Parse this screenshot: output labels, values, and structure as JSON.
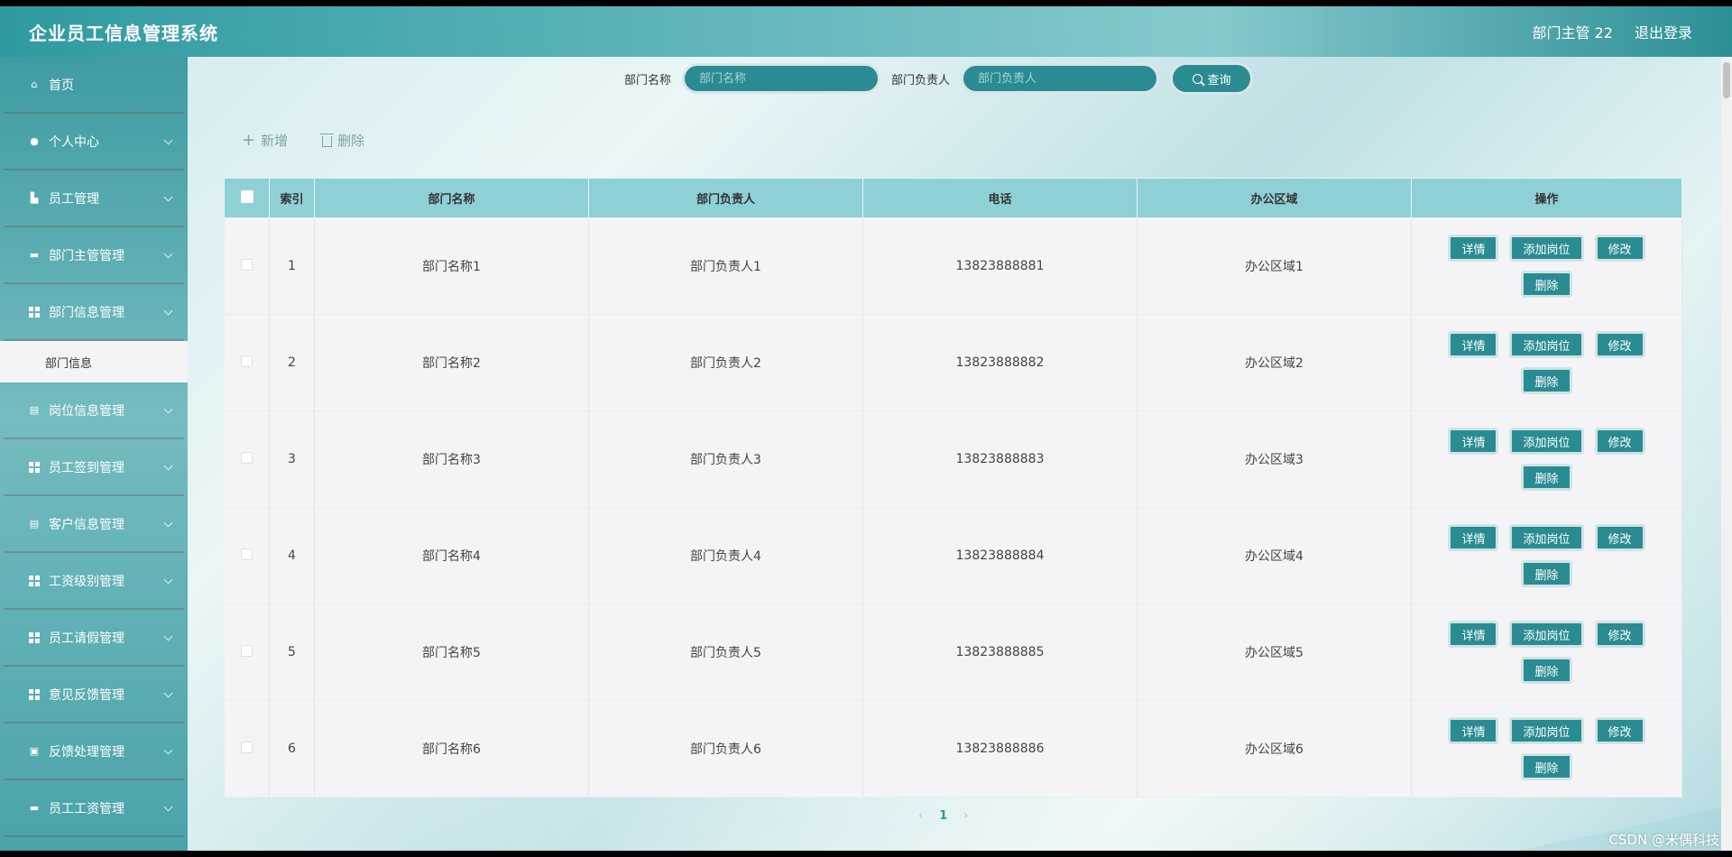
{
  "app": {
    "title": "企业员工信息管理系统"
  },
  "topbar": {
    "user": "部门主管 22",
    "logout": "退出登录"
  },
  "sidebar": {
    "items": [
      {
        "label": "首页",
        "icon": "home-icon"
      },
      {
        "label": "个人中心",
        "icon": "user-icon"
      },
      {
        "label": "员工管理",
        "icon": "building-icon"
      },
      {
        "label": "部门主管管理",
        "icon": "briefcase-icon"
      },
      {
        "label": "部门信息管理",
        "icon": "grid-icon"
      },
      {
        "label": "部门信息",
        "icon": ""
      },
      {
        "label": "岗位信息管理",
        "icon": "clipboard-icon"
      },
      {
        "label": "员工签到管理",
        "icon": "grid-icon"
      },
      {
        "label": "客户信息管理",
        "icon": "clipboard-icon"
      },
      {
        "label": "工资级别管理",
        "icon": "grid-icon"
      },
      {
        "label": "员工请假管理",
        "icon": "grid-icon"
      },
      {
        "label": "意见反馈管理",
        "icon": "grid-icon"
      },
      {
        "label": "反馈处理管理",
        "icon": "printer-icon"
      },
      {
        "label": "员工工资管理",
        "icon": "chat-icon"
      }
    ]
  },
  "search": {
    "dept_name_label": "部门名称",
    "dept_name_placeholder": "部门名称",
    "dept_head_label": "部门负责人",
    "dept_head_placeholder": "部门负责人",
    "query_label": "查询"
  },
  "toolbar": {
    "add_label": "新增",
    "delete_label": "删除"
  },
  "table": {
    "headers": [
      "索引",
      "部门名称",
      "部门负责人",
      "电话",
      "办公区域",
      "操作"
    ],
    "rows": [
      {
        "index": "1",
        "name": "部门名称1",
        "head": "部门负责人1",
        "phone": "13823888881",
        "area": "办公区域1"
      },
      {
        "index": "2",
        "name": "部门名称2",
        "head": "部门负责人2",
        "phone": "13823888882",
        "area": "办公区域2"
      },
      {
        "index": "3",
        "name": "部门名称3",
        "head": "部门负责人3",
        "phone": "13823888883",
        "area": "办公区域3"
      },
      {
        "index": "4",
        "name": "部门名称4",
        "head": "部门负责人4",
        "phone": "13823888884",
        "area": "办公区域4"
      },
      {
        "index": "5",
        "name": "部门名称5",
        "head": "部门负责人5",
        "phone": "13823888885",
        "area": "办公区域5"
      },
      {
        "index": "6",
        "name": "部门名称6",
        "head": "部门负责人6",
        "phone": "13823888886",
        "area": "办公区域6"
      }
    ],
    "ops": {
      "detail": "详情",
      "add_post": "添加岗位",
      "edit": "修改",
      "delete": "删除"
    }
  },
  "pager": {
    "prev": "‹",
    "current": "1",
    "next": "›"
  },
  "watermark": "CSDN @米偶科技",
  "colors": {
    "accent": "#2a8c92",
    "header": "#8fd0d6"
  }
}
